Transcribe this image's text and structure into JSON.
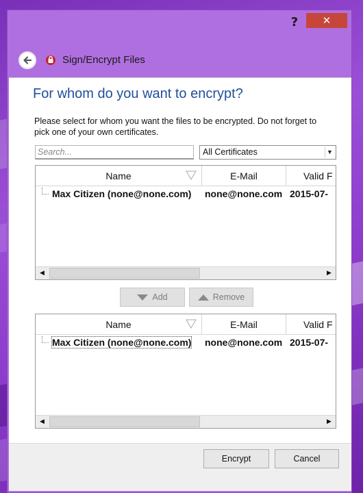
{
  "window": {
    "help_label": "?",
    "close_label": "✕",
    "title": "Sign/Encrypt Files"
  },
  "page": {
    "heading": "For whom do you want to encrypt?",
    "instructions": "Please select for whom you want the files to be encrypted. Do not forget to pick one of your own certificates."
  },
  "search": {
    "placeholder": "Search..."
  },
  "filter": {
    "selected": "All Certificates"
  },
  "available_table": {
    "columns": [
      "Name",
      "E-Mail",
      "Valid F"
    ],
    "rows": [
      {
        "name": "Max Citizen (none@none.com)",
        "email": "none@none.com",
        "valid_from": "2015-07-"
      }
    ]
  },
  "actions": {
    "add_label": "Add",
    "remove_label": "Remove"
  },
  "selected_table": {
    "columns": [
      "Name",
      "E-Mail",
      "Valid F"
    ],
    "rows": [
      {
        "name": "Max Citizen (none@none.com)",
        "email": "none@none.com",
        "valid_from": "2015-07-"
      }
    ]
  },
  "footer": {
    "encrypt_label": "Encrypt",
    "cancel_label": "Cancel"
  },
  "colors": {
    "accent": "#1e4f9a",
    "close": "#c7463c",
    "window_frame": "#b06fe0"
  }
}
